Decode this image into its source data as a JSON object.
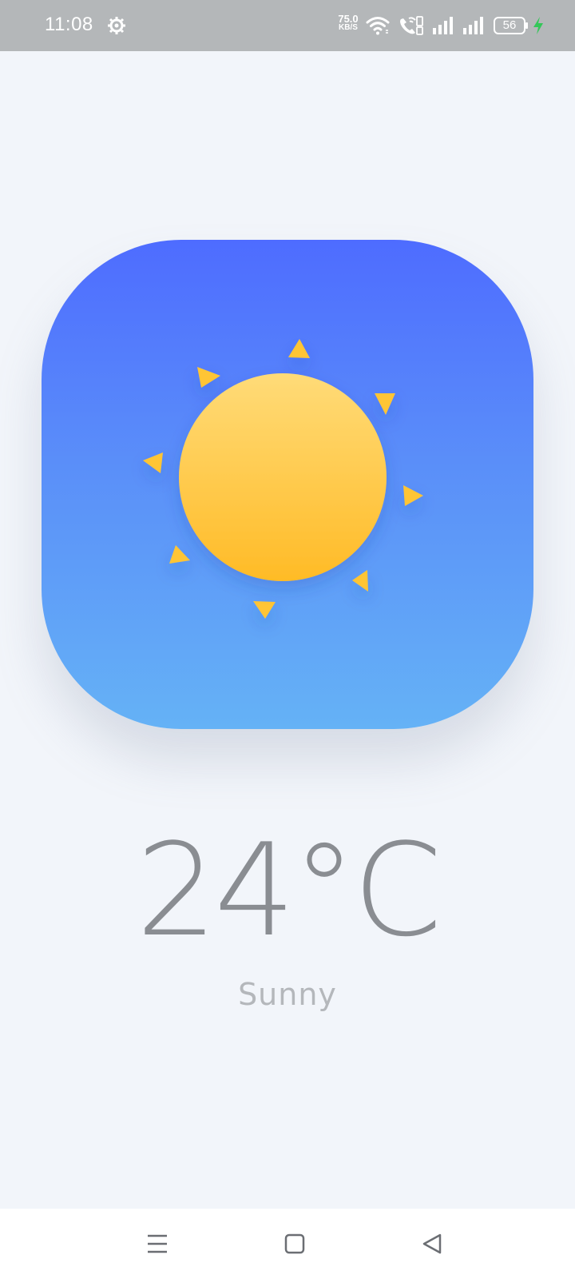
{
  "status_bar": {
    "time": "11:08",
    "network_speed_value": "75.0",
    "network_speed_unit": "KB/S",
    "battery_level": "56",
    "icons": [
      "settings-gear-icon",
      "wifi-icon",
      "volte-call-icon",
      "signal-icon",
      "signal-icon",
      "battery-icon",
      "charging-bolt-icon"
    ],
    "charging_color": "#34c759"
  },
  "weather": {
    "temperature": "24°C",
    "condition": "Sunny",
    "icon": "sun-icon",
    "card_gradient_top": "#4e6cff",
    "card_gradient_bottom": "#65b2f6",
    "sun_color": "#ffc534"
  },
  "nav_bar": {
    "buttons": [
      "menu-icon",
      "home-icon",
      "back-icon"
    ]
  }
}
